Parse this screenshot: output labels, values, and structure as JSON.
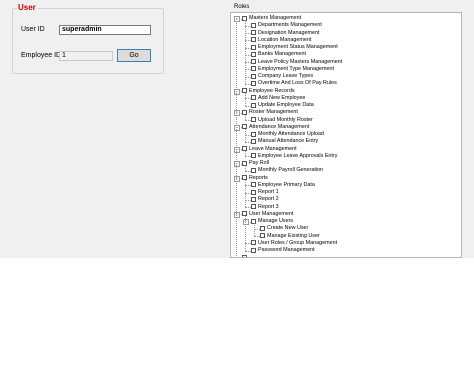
{
  "user_group": {
    "legend": "User",
    "user_id_label": "User ID",
    "user_id_value": "superadmin",
    "employee_id_label": "Employee ID",
    "employee_id_value": "1",
    "go_label": "Go"
  },
  "roles": {
    "label": "Roles",
    "tree": [
      {
        "label": "Masters Management",
        "children": [
          {
            "label": "Departments Management"
          },
          {
            "label": "Designation Management"
          },
          {
            "label": "Location Management"
          },
          {
            "label": "Employment Status Management"
          },
          {
            "label": "Banks Management"
          },
          {
            "label": "Leave Policy Masters Management"
          },
          {
            "label": "Employment Type Management"
          },
          {
            "label": "Company Leave Types"
          },
          {
            "label": "Overtime And Loss Of Pay Rules"
          }
        ]
      },
      {
        "label": "Employee Records",
        "children": [
          {
            "label": "Add New Employee"
          },
          {
            "label": "Update Employee Data"
          }
        ]
      },
      {
        "label": "Roster Management",
        "children": [
          {
            "label": "Upload Monthly Roster"
          }
        ]
      },
      {
        "label": "Attendance Management",
        "children": [
          {
            "label": "Monthly Attendance Upload"
          },
          {
            "label": "Manual Attendance Entry"
          }
        ]
      },
      {
        "label": "Leave Management",
        "children": [
          {
            "label": "Employee Leave Approvals Entry"
          }
        ]
      },
      {
        "label": "Pay Roll",
        "children": [
          {
            "label": "Monthly Payroll Generation"
          }
        ]
      },
      {
        "label": "Reports",
        "children": [
          {
            "label": "Employee Primary Data"
          },
          {
            "label": "Report 1"
          },
          {
            "label": "Report 2"
          },
          {
            "label": "Report 3"
          }
        ]
      },
      {
        "label": "User Management",
        "children": [
          {
            "label": "Manage Users",
            "children": [
              {
                "label": "Create New User"
              },
              {
                "label": "Manage Existing User"
              }
            ]
          },
          {
            "label": "User Roles / Group Management"
          },
          {
            "label": "Password Management"
          }
        ]
      },
      {
        "label": ""
      }
    ]
  }
}
